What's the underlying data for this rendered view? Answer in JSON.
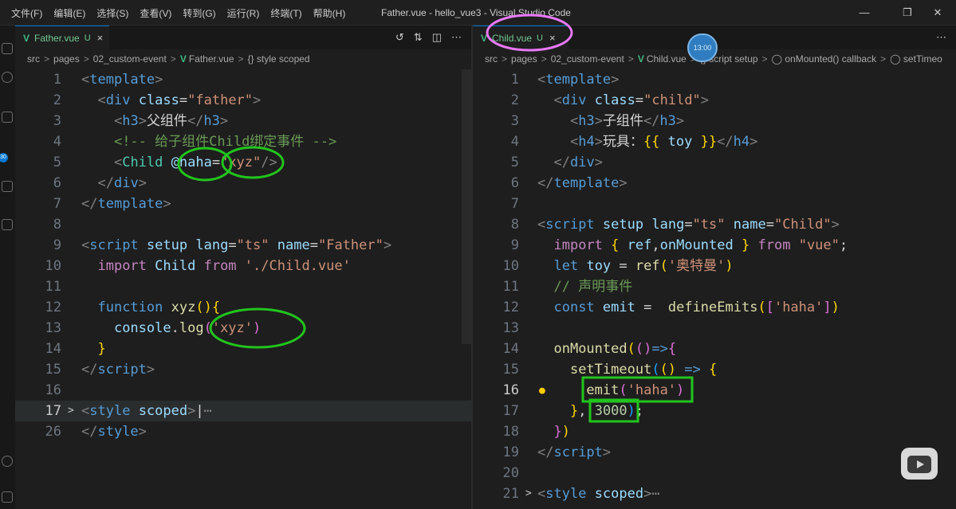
{
  "menu": [
    "文件(F)",
    "编辑(E)",
    "选择(S)",
    "查看(V)",
    "转到(G)",
    "运行(R)",
    "终端(T)",
    "帮助(H)"
  ],
  "window_title": "Father.vue - hello_vue3 - Visual Studio Code",
  "timer_badge": "13:00",
  "activity_badge": "30",
  "left": {
    "tab": {
      "icon": "V",
      "name": "Father.vue",
      "status": "U",
      "close": "×"
    },
    "breadcrumb": [
      "src",
      "pages",
      "02_custom-event",
      "Father.vue",
      "{} style scoped"
    ],
    "line_numbers": [
      "1",
      "2",
      "3",
      "4",
      "5",
      "6",
      "7",
      "8",
      "9",
      "10",
      "11",
      "12",
      "13",
      "14",
      "15",
      "16",
      "17",
      "26"
    ]
  },
  "right": {
    "tab": {
      "icon": "V",
      "name": "Child.vue",
      "status": "U",
      "close": "×"
    },
    "breadcrumb": [
      "src",
      "pages",
      "02_custom-event",
      "Child.vue",
      "{} script setup",
      "onMounted() callback",
      "setTimeo"
    ],
    "line_numbers": [
      "1",
      "2",
      "3",
      "4",
      "5",
      "6",
      "7",
      "8",
      "9",
      "10",
      "11",
      "12",
      "13",
      "14",
      "15",
      "16",
      "17",
      "18",
      "19",
      "20",
      "21"
    ]
  },
  "colors": {
    "annotation_green": "#22c41d",
    "annotation_pink": "#e879f9",
    "vue_green": "#41b883",
    "accent": "#0078d4"
  }
}
